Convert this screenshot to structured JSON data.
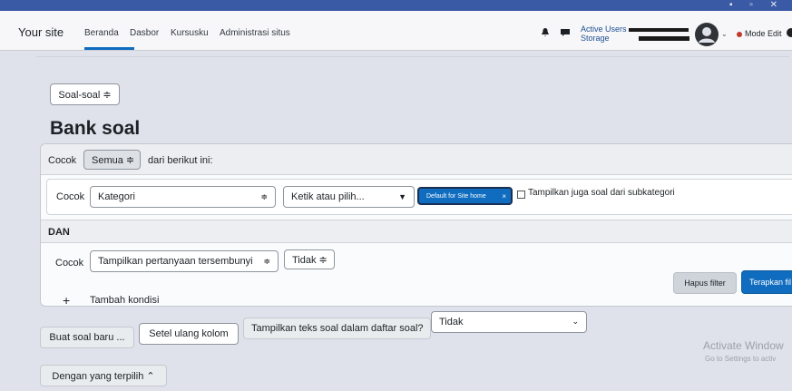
{
  "window": {
    "controls": "▪ ▫ ✕"
  },
  "navbar": {
    "site_name": "Your site",
    "links": [
      "Beranda",
      "Dasbor",
      "Kursusku",
      "Administrasi situs"
    ],
    "active_users_line1": "Active Users",
    "active_users_line2": "Storage",
    "mode_edit": "Mode Edit",
    "avatar_caret": "⌄"
  },
  "page": {
    "question_bank_select": "Soal-soal ≑",
    "title": "Bank soal"
  },
  "filter": {
    "cocok_label": "Cocok",
    "match_all_select": "Semua ≑",
    "from_following": "dari berikut ini:",
    "cond1": {
      "cocok_label": "Cocok",
      "field_select": "Kategori",
      "field_caret": "≑",
      "search_input": "Ketik atau pilih...",
      "search_caret": "▼",
      "chip_label": "Default for Site home",
      "chip_remove": "×",
      "subcat_checkbox_label": "Tampilkan juga soal dari subkategori"
    },
    "and_label": "DAN",
    "cond2": {
      "cocok_label": "Cocok",
      "field_select": "Tampilkan pertanyaan tersembunyi",
      "field_caret": "≑",
      "value_select": "Tidak ≑"
    },
    "add_condition_icon": "+",
    "add_condition_label": "Tambah kondisi",
    "clear_button": "Hapus filter",
    "apply_button": "Terapkan fil"
  },
  "actions": {
    "new_question_button": "Buat soal baru ...",
    "reset_columns_button": "Setel ulang kolom",
    "show_text_label": "Tampilkan teks soal dalam daftar soal?",
    "show_text_select": "Tidak",
    "show_text_caret": "⌄",
    "with_selected_button": "Dengan yang terpilih ⌃"
  },
  "watermark": {
    "line1": "Activate Window",
    "line2": "Go to Settings to activ"
  },
  "colors": {
    "primary": "#0f6cbf",
    "background": "#dfe2ea",
    "status_red": "#c0392b"
  }
}
